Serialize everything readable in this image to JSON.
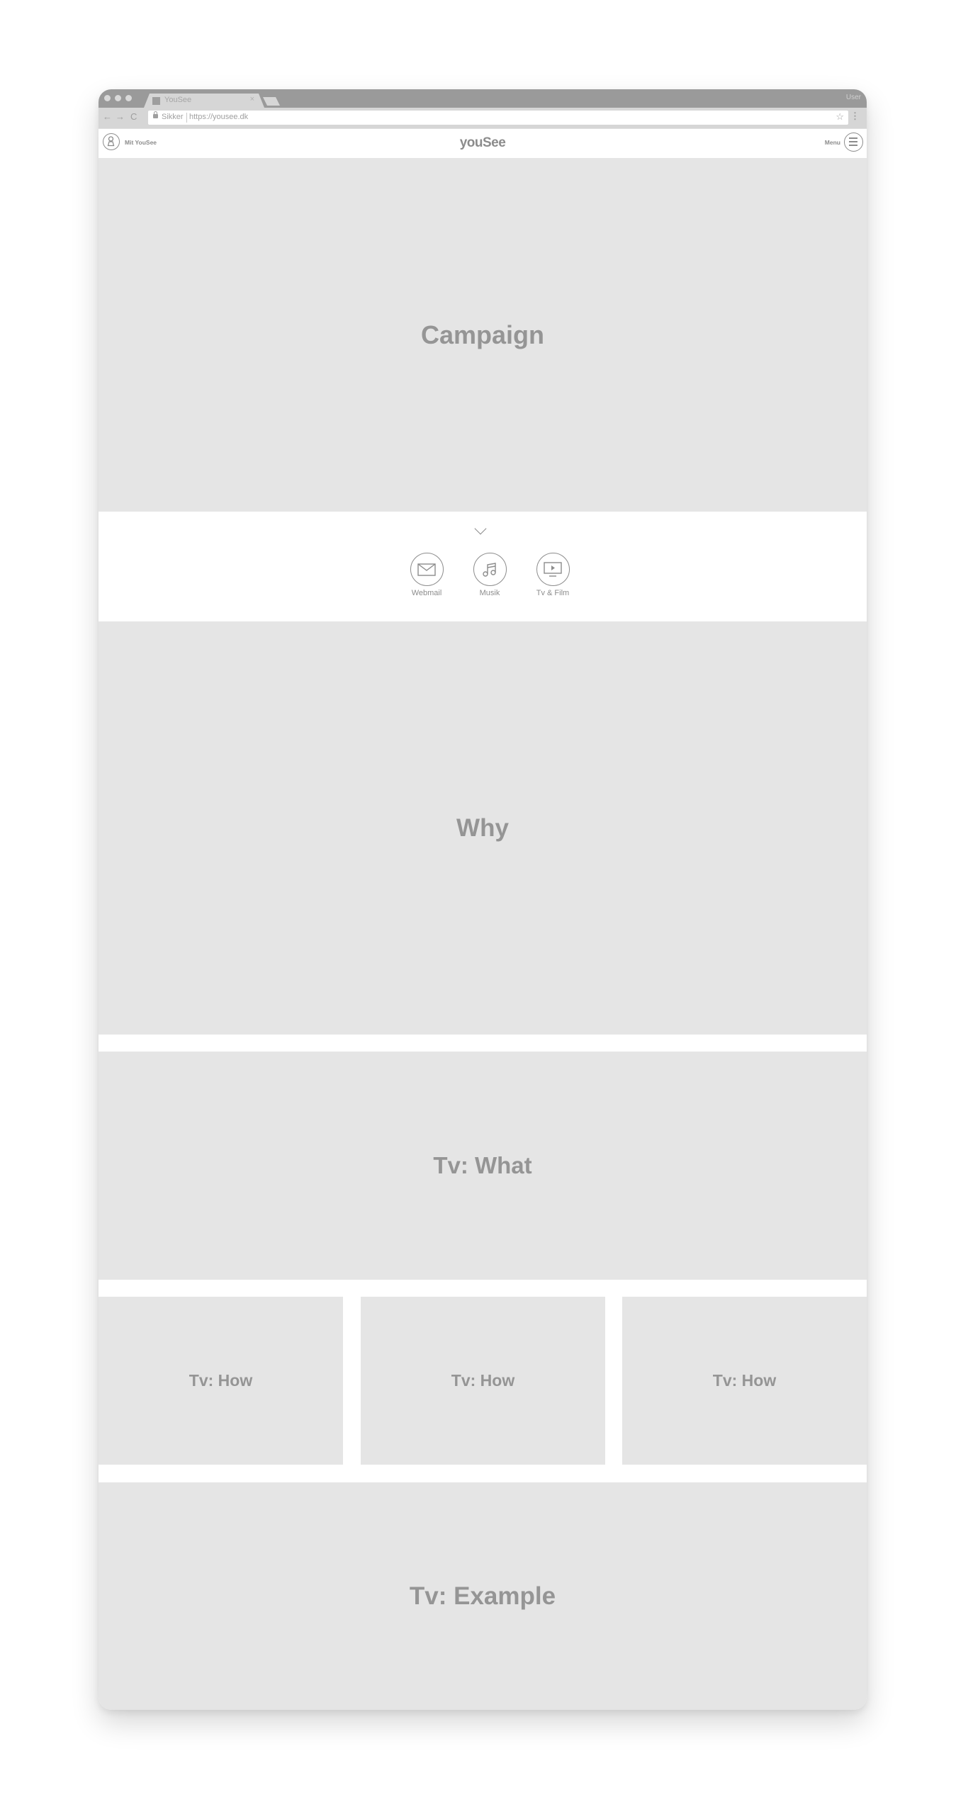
{
  "browser": {
    "tab_title": "YouSee",
    "tab_close": "×",
    "user_label": "User",
    "secure_label": "Sikker",
    "url": "https://yousee.dk",
    "star_icon": "☆",
    "kebab_icon": "⋮",
    "back_icon": "←",
    "forward_icon": "→",
    "reload_icon": "C"
  },
  "header": {
    "account_label": "Mit YouSee",
    "logo": "youSee",
    "menu_label": "Menu"
  },
  "quicklinks": [
    {
      "label": "Webmail",
      "icon": "envelope-icon"
    },
    {
      "label": "Musik",
      "icon": "music-note-icon"
    },
    {
      "label": "Tv & Film",
      "icon": "tv-play-icon"
    }
  ],
  "sections": {
    "campaign": "Campaign",
    "why": "Why",
    "what": "Tv: What",
    "how": [
      "Tv: How",
      "Tv: How",
      "Tv: How"
    ],
    "example": "Tv: Example"
  },
  "colors": {
    "placeholder_bg": "#e5e5e5",
    "placeholder_text": "#959595",
    "chrome_dark": "#9a9a9a",
    "chrome_light": "#d6d6d6"
  }
}
